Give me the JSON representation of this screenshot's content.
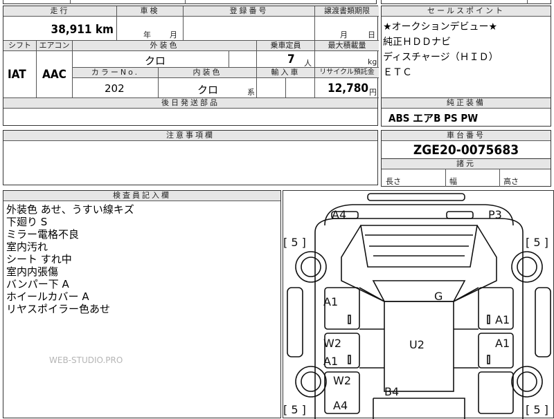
{
  "top_fragment": "",
  "mileage": {
    "label": "走行",
    "value": "38,911 km"
  },
  "shaken": {
    "label": "車検",
    "year_unit": "年",
    "month_unit": "月"
  },
  "registration": {
    "label": "登録番号",
    "value": ""
  },
  "transfer_deadline": {
    "label": "譲渡書類期限",
    "month_unit": "月",
    "day_unit": "日"
  },
  "shift": {
    "label": "シフト",
    "value": "IAT"
  },
  "aircon": {
    "label": "エアコン",
    "value": "AAC"
  },
  "exterior_color": {
    "label": "外装色",
    "value": "クロ"
  },
  "capacity": {
    "label": "乗車定員",
    "value": "7",
    "unit": "人"
  },
  "max_load": {
    "label": "最大積載量",
    "unit": "kg"
  },
  "color_no": {
    "label": "カラーNo.",
    "value": "202"
  },
  "interior_color": {
    "label": "内装色",
    "value": "クロ",
    "suffix": "系"
  },
  "import": {
    "label": "輸入車"
  },
  "recycle": {
    "label": "リサイクル預託金",
    "value": "12,780",
    "unit": "円"
  },
  "later_parts": {
    "label": "後日発送部品"
  },
  "notes": {
    "label": "注意事項欄"
  },
  "sales_points": {
    "label": "セールスポイント",
    "items": [
      "★オークションデビュー★",
      "純正ＨＤＤナビ",
      "ディスチャージ（ＨＩＤ）",
      "ＥＴＣ"
    ]
  },
  "genuine_equipment": {
    "label": "純正装備",
    "value": "ABS エアB PS PW"
  },
  "chassis": {
    "label": "車台番号",
    "value": "ZGE20-0075683"
  },
  "dimensions": {
    "label": "諸元",
    "length": "長さ",
    "width": "幅",
    "height": "高さ"
  },
  "inspector": {
    "label": "検査員記入欄",
    "lines": [
      "外装色 あせ、うすい線キズ",
      "下廻り S",
      "ミラー電格不良",
      "室内汚れ",
      "シート すれ中",
      "室内内張傷",
      "バンパー下 A",
      "ホイールカバー A",
      "リヤスポイラー色あせ"
    ],
    "watermark": "WEB-STUDIO.PRO"
  },
  "car_diagram": {
    "marks": [
      "A4",
      "P3",
      "A1",
      "G",
      "A1",
      "W2",
      "U2",
      "A1",
      "A1",
      "W2",
      "A4",
      "B4"
    ],
    "tire_marks": [
      "[ 5 ]",
      "[ 5 ]",
      "[ 5 ]",
      "[ 5 ]"
    ]
  }
}
